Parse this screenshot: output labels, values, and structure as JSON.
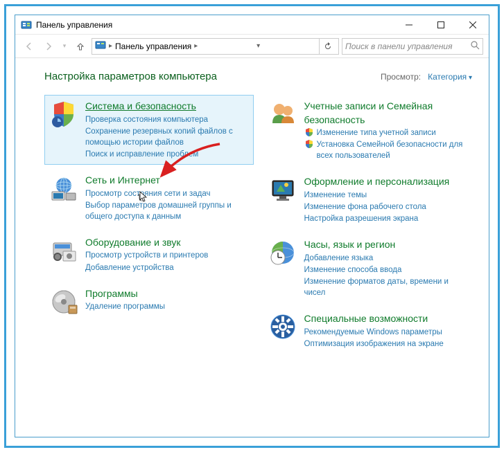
{
  "window": {
    "title": "Панель управления"
  },
  "nav": {
    "breadcrumb": "Панель управления",
    "search_placeholder": "Поиск в панели управления"
  },
  "page": {
    "heading": "Настройка параметров компьютера",
    "view_label": "Просмотр:",
    "view_value": "Категория"
  },
  "left": [
    {
      "title": "Система и безопасность",
      "subs": [
        "Проверка состояния компьютера",
        "Сохранение резервных копий файлов с помощью истории файлов",
        "Поиск и исправление проблем"
      ],
      "highlight": true,
      "icon": "shield"
    },
    {
      "title": "Сеть и Интернет",
      "subs": [
        "Просмотр состояния сети и задач",
        "Выбор параметров домашней группы и общего доступа к данным"
      ],
      "icon": "network"
    },
    {
      "title": "Оборудование и звук",
      "subs": [
        "Просмотр устройств и принтеров",
        "Добавление устройства"
      ],
      "icon": "hardware"
    },
    {
      "title": "Программы",
      "subs": [
        "Удаление программы"
      ],
      "icon": "programs"
    }
  ],
  "right": [
    {
      "title": "Учетные записи и Семейная безопасность",
      "subs": [
        {
          "text": "Изменение типа учетной записи",
          "shield": true
        },
        {
          "text": "Установка Семейной безопасности для всех пользователей",
          "shield": true
        }
      ],
      "icon": "users"
    },
    {
      "title": "Оформление и персонализация",
      "subs": [
        "Изменение темы",
        "Изменение фона рабочего стола",
        "Настройка разрешения экрана"
      ],
      "icon": "appearance"
    },
    {
      "title": "Часы, язык и регион",
      "subs": [
        "Добавление языка",
        "Изменение способа ввода",
        "Изменение форматов даты, времени и чисел"
      ],
      "icon": "clock"
    },
    {
      "title": "Специальные возможности",
      "subs": [
        "Рекомендуемые Windows параметры",
        "Оптимизация изображения на экране"
      ],
      "icon": "ease"
    }
  ]
}
